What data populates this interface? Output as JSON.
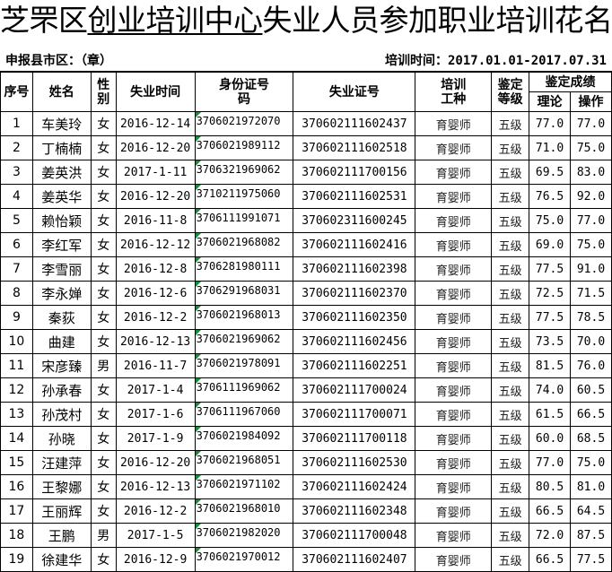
{
  "document": {
    "title_prefix": "芝罘区",
    "title_underlined": "创业培训中心",
    "title_suffix": "失业人员参加职业培训花名册"
  },
  "meta": {
    "county_label": "申报县市区：（章）",
    "period_label": "培训时间：2017.01.01-2017.07.31"
  },
  "columns": {
    "no": "序号",
    "name": "姓名",
    "gender": "性别",
    "unemployed_time": "失业时间",
    "id_number": "身份证号码",
    "unemployment_cert": "失业证号",
    "training_type": "培训工种",
    "level": "鉴定等级",
    "score_group": "鉴定成绩",
    "theory": "理论",
    "practice": "操作"
  },
  "rows": [
    {
      "no": "1",
      "name": "车美玲",
      "gender": "女",
      "date": "2016-12-14",
      "id": "3706021972070",
      "cert": "370602111602437",
      "type": "育婴师",
      "level": "五级",
      "theory": "77.0",
      "practice": "77.0"
    },
    {
      "no": "2",
      "name": "丁楠楠",
      "gender": "女",
      "date": "2016-12-20",
      "id": "3706021989112",
      "cert": "370602111602518",
      "type": "育婴师",
      "level": "五级",
      "theory": "71.0",
      "practice": "75.0"
    },
    {
      "no": "3",
      "name": "姜英洪",
      "gender": "女",
      "date": "2017-1-11",
      "id": "3706321969062",
      "cert": "370602111700156",
      "type": "育婴师",
      "level": "五级",
      "theory": "69.5",
      "practice": "83.0"
    },
    {
      "no": "4",
      "name": "姜英华",
      "gender": "女",
      "date": "2016-12-20",
      "id": "3710211975060",
      "cert": "370602111602531",
      "type": "育婴师",
      "level": "五级",
      "theory": "76.5",
      "practice": "92.0"
    },
    {
      "no": "5",
      "name": "赖怡颖",
      "gender": "女",
      "date": "2016-11-8",
      "id": "3706111991071",
      "cert": "370602311600245",
      "type": "育婴师",
      "level": "五级",
      "theory": "75.0",
      "practice": "77.0"
    },
    {
      "no": "6",
      "name": "李红军",
      "gender": "女",
      "date": "2016-12-12",
      "id": "3706021968082",
      "cert": "370602111602416",
      "type": "育婴师",
      "level": "五级",
      "theory": "69.0",
      "practice": "75.0"
    },
    {
      "no": "7",
      "name": "李雪丽",
      "gender": "女",
      "date": "2016-12-8",
      "id": "3706281980111",
      "cert": "370602111602398",
      "type": "育婴师",
      "level": "五级",
      "theory": "77.5",
      "practice": "91.0"
    },
    {
      "no": "8",
      "name": "李永婵",
      "gender": "女",
      "date": "2016-12-6",
      "id": "3706291968031",
      "cert": "370602111602370",
      "type": "育婴师",
      "level": "五级",
      "theory": "72.5",
      "practice": "71.5"
    },
    {
      "no": "9",
      "name": "秦荻",
      "gender": "女",
      "date": "2016-12-2",
      "id": "3706021968013",
      "cert": "370602111602350",
      "type": "育婴师",
      "level": "五级",
      "theory": "77.5",
      "practice": "78.5"
    },
    {
      "no": "10",
      "name": "曲建",
      "gender": "女",
      "date": "2016-12-13",
      "id": "3706021969062",
      "cert": "370602111602456",
      "type": "育婴师",
      "level": "五级",
      "theory": "73.5",
      "practice": "70.0"
    },
    {
      "no": "11",
      "name": "宋彦臻",
      "gender": "男",
      "date": "2016-11-7",
      "id": "3706021978091",
      "cert": "370602111602251",
      "type": "育婴师",
      "level": "五级",
      "theory": "81.5",
      "practice": "76.0"
    },
    {
      "no": "12",
      "name": "孙承春",
      "gender": "女",
      "date": "2017-1-4",
      "id": "3706111969062",
      "cert": "370602111700024",
      "type": "育婴师",
      "level": "五级",
      "theory": "74.0",
      "practice": "60.5"
    },
    {
      "no": "13",
      "name": "孙茂村",
      "gender": "女",
      "date": "2017-1-6",
      "id": "3706111967060",
      "cert": "370602111700071",
      "type": "育婴师",
      "level": "五级",
      "theory": "61.5",
      "practice": "66.5"
    },
    {
      "no": "14",
      "name": "孙晓",
      "gender": "女",
      "date": "2017-1-9",
      "id": "3706021984092",
      "cert": "370602111700118",
      "type": "育婴师",
      "level": "五级",
      "theory": "60.0",
      "practice": "68.5"
    },
    {
      "no": "15",
      "name": "汪建萍",
      "gender": "女",
      "date": "2016-12-20",
      "id": "3706021968051",
      "cert": "370602111602530",
      "type": "育婴师",
      "level": "五级",
      "theory": "77.0",
      "practice": "75.0"
    },
    {
      "no": "16",
      "name": "王黎娜",
      "gender": "女",
      "date": "2016-12-13",
      "id": "3706021971102",
      "cert": "370602111602424",
      "type": "育婴师",
      "level": "五级",
      "theory": "80.5",
      "practice": "81.0"
    },
    {
      "no": "17",
      "name": "王丽辉",
      "gender": "女",
      "date": "2016-12-2",
      "id": "3706021968010",
      "cert": "370602111602348",
      "type": "育婴师",
      "level": "五级",
      "theory": "66.5",
      "practice": "64.5"
    },
    {
      "no": "18",
      "name": "王鹏",
      "gender": "男",
      "date": "2017-1-5",
      "id": "3706021982020",
      "cert": "370602111700048",
      "type": "育婴师",
      "level": "五级",
      "theory": "72.0",
      "practice": "87.5"
    },
    {
      "no": "19",
      "name": "徐建华",
      "gender": "女",
      "date": "2016-12-9",
      "id": "3706021970012",
      "cert": "370602111602407",
      "type": "育婴师",
      "level": "五级",
      "theory": "66.5",
      "practice": "77.5"
    }
  ]
}
